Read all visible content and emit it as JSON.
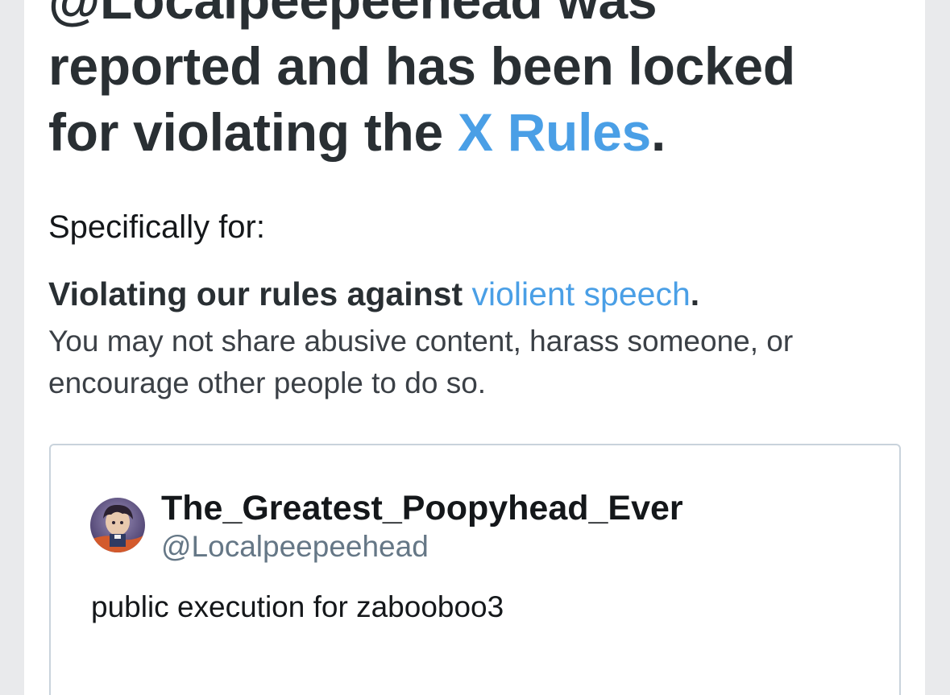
{
  "notice": {
    "headline_line1": "@Localpeepeehead was",
    "headline_line2": "reported and has been locked",
    "headline_line3_prefix": "for violating the ",
    "headline_rules_link": "X Rules",
    "headline_period": "."
  },
  "reason": {
    "intro": "Specifically for:",
    "rule_prefix": "Violating our rules against ",
    "rule_link": "violient speech",
    "rule_period": ".",
    "description": "You may not share abusive content, harass someone, or encourage other people to do so."
  },
  "tweet": {
    "display_name": "The_Greatest_Poopyhead_Ever",
    "handle": "@Localpeepeehead",
    "text": "public execution for zabooboo3",
    "avatar_icon": "avatar-image"
  },
  "colors": {
    "link": "#4a9fe6",
    "headline_text": "#292f33",
    "handle_text": "#657786",
    "border": "#c9d3dc"
  }
}
